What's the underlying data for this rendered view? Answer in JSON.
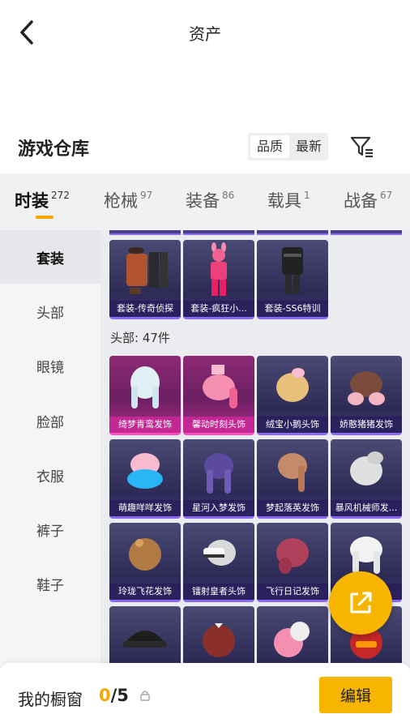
{
  "header": {
    "title": "资产"
  },
  "section": {
    "title": "游戏仓库"
  },
  "sort": {
    "options": [
      "品质",
      "最新"
    ],
    "selected": "品质"
  },
  "tabs": [
    {
      "label": "时装",
      "count": "272",
      "active": true
    },
    {
      "label": "枪械",
      "count": "97"
    },
    {
      "label": "装备",
      "count": "86"
    },
    {
      "label": "载具",
      "count": "1"
    },
    {
      "label": "战备",
      "count": "67"
    }
  ],
  "sidebar": {
    "items": [
      "套装",
      "头部",
      "眼镜",
      "脸部",
      "衣服",
      "裤子",
      "鞋子"
    ],
    "active": "套装"
  },
  "outfits": [
    {
      "name": "套装-传奇侦探"
    },
    {
      "name": "套装-疯狂小..."
    },
    {
      "name": "套装-SS6特训"
    }
  ],
  "head_group": {
    "heading": "头部: 47件"
  },
  "head_items": [
    {
      "name": "绮梦青鸾发饰",
      "rarity": "pink"
    },
    {
      "name": "馨动时刻头饰",
      "rarity": "pink"
    },
    {
      "name": "绒宝小鹅头饰",
      "rarity": "purple"
    },
    {
      "name": "娇憨猪猪发饰",
      "rarity": "purple"
    },
    {
      "name": "萌趣咩咩发饰",
      "rarity": "purple"
    },
    {
      "name": "星河入梦发饰",
      "rarity": "purple"
    },
    {
      "name": "梦起落英发饰",
      "rarity": "purple"
    },
    {
      "name": "暴风机械师发...",
      "rarity": "purple"
    },
    {
      "name": "玲珑飞花发饰",
      "rarity": "purple"
    },
    {
      "name": "镭射皇者头饰",
      "rarity": "purple"
    },
    {
      "name": "飞行日记发饰",
      "rarity": "purple"
    },
    {
      "name": "",
      "rarity": "purple"
    }
  ],
  "bottom": {
    "showcase_label": "我的橱窗",
    "showcase_current": "0",
    "showcase_total": "/5",
    "edit_label": "编辑"
  },
  "colors": {
    "accent": "#f7b500",
    "rare_pink": "#ff4fbf",
    "rare_purple": "#8d6af5"
  }
}
